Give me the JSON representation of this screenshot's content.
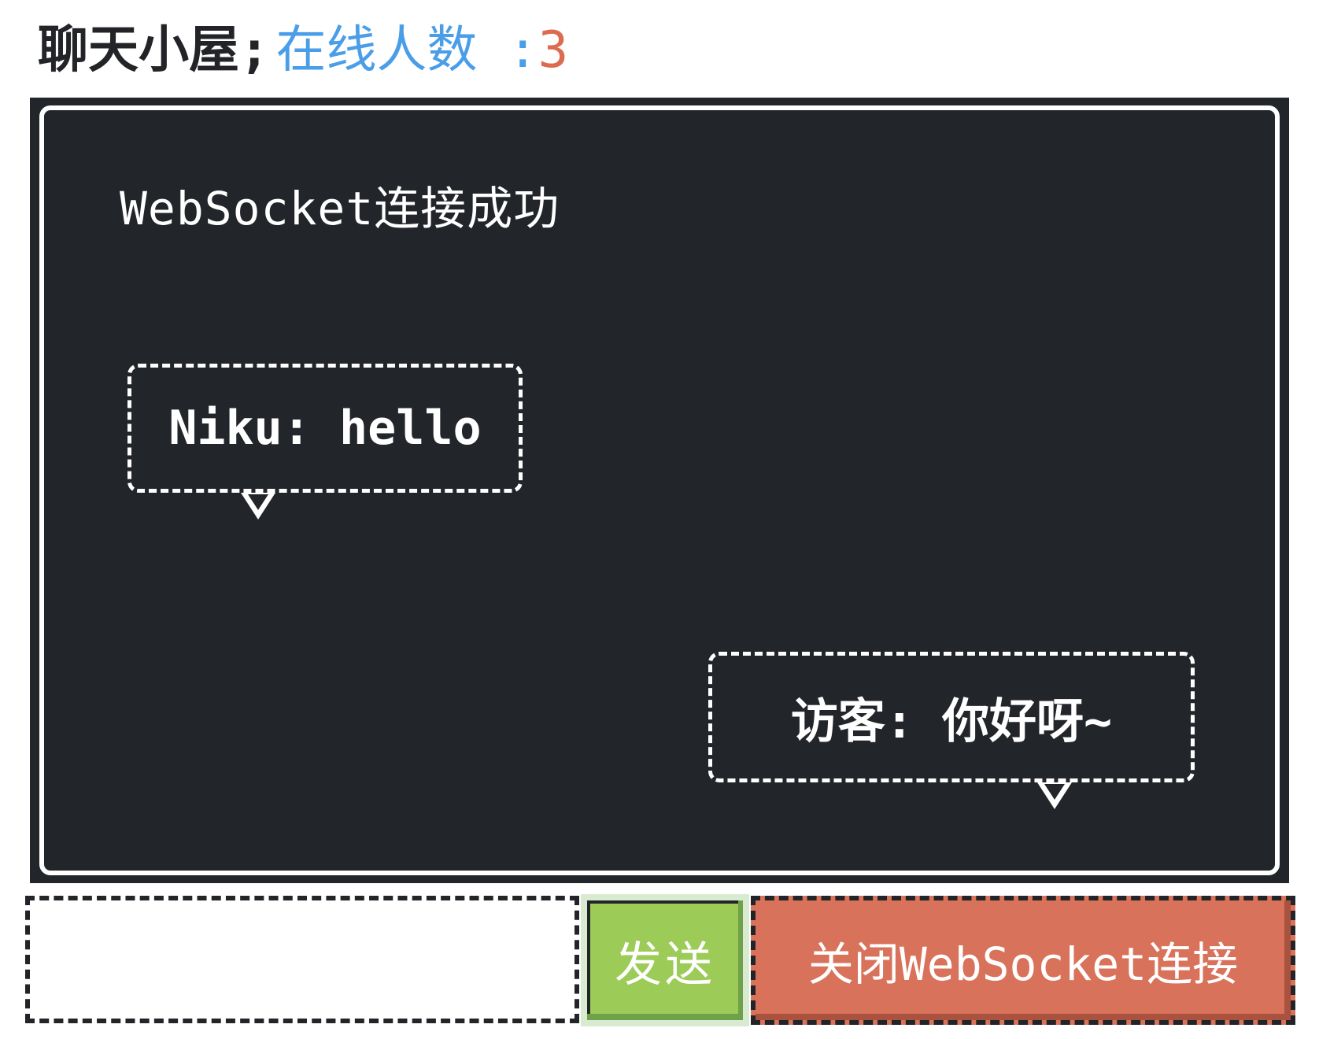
{
  "header": {
    "title": "聊天小屋",
    "separator": ";",
    "online_label": "在线人数 :",
    "online_count": "3"
  },
  "chat": {
    "system_message": "WebSocket连接成功",
    "messages": [
      {
        "text": "Niku: hello",
        "side": "left"
      },
      {
        "text": "访客: 你好呀~",
        "side": "right"
      }
    ]
  },
  "composer": {
    "input_value": "",
    "input_placeholder": "",
    "send_label": "发送",
    "close_label": "关闭WebSocket连接"
  },
  "colors": {
    "chat_background": "#22252a",
    "online_label": "#4a9ee8",
    "online_count": "#db6c4f",
    "send_button": "#9ccb58",
    "close_button": "#d9725a"
  }
}
